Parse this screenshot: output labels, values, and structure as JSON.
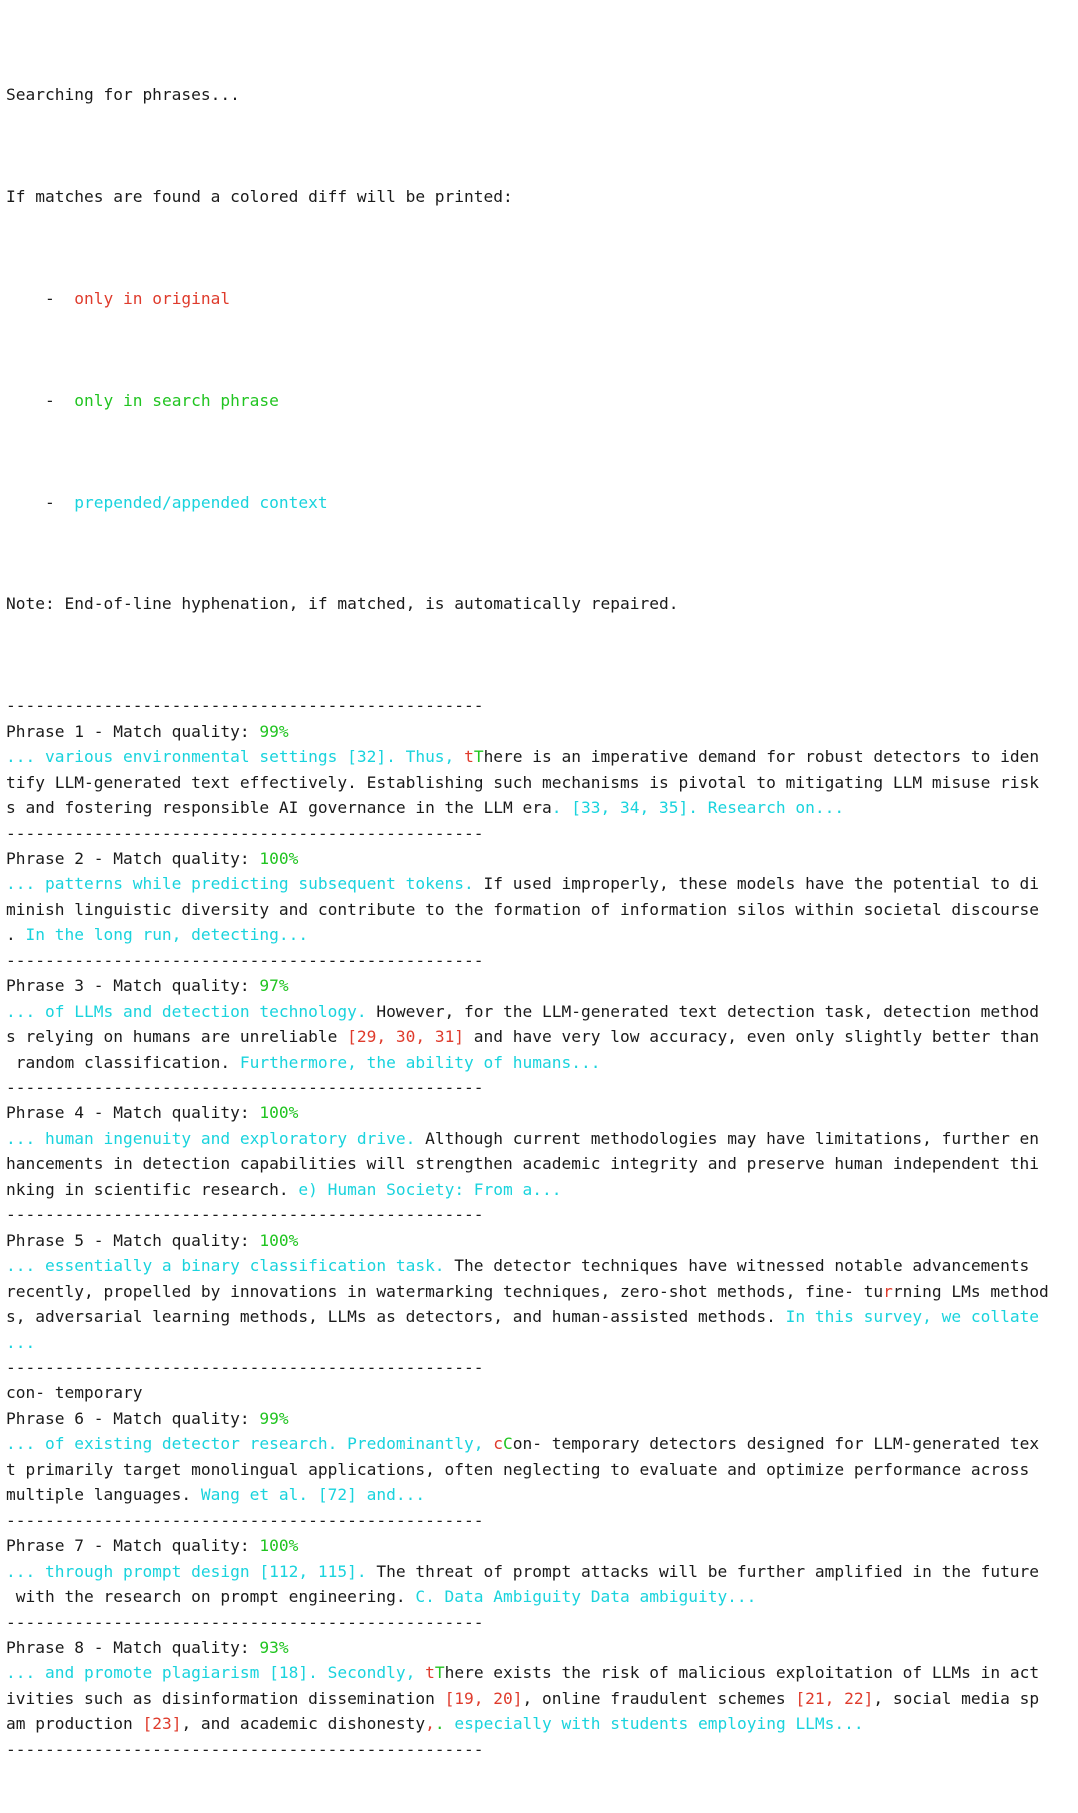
{
  "terminal": {
    "colors": {
      "text": "#1a1a1a",
      "removed": "#df3b2c",
      "added": "#21c421",
      "context": "#19d3dd",
      "background": "#ffffff"
    },
    "rule": "-------------------------------------------------",
    "header": {
      "line1": "Searching for phrases...",
      "line2": "If matches are found a colored diff will be printed:",
      "legend": [
        {
          "bullet": "    -  ",
          "label": "only in original",
          "color": "removed"
        },
        {
          "bullet": "    -  ",
          "label": "only in search phrase",
          "color": "added"
        },
        {
          "bullet": "    -  ",
          "label": "prepended/appended context",
          "color": "context"
        }
      ],
      "note": "Note: End-of-line hyphenation, if matched, is automatically repaired."
    },
    "stray_line": "con- temporary",
    "phrases": [
      {
        "label": "Phrase 1 - Match quality: ",
        "quality": "99%",
        "lines": [
          [
            {
              "t": "... various environmental settings [32]. Thus, ",
              "c": "context"
            },
            {
              "t": "t",
              "c": "removed"
            },
            {
              "t": "T",
              "c": "added"
            },
            {
              "t": "here is an imperative demand for robust detectors to iden",
              "c": "plain"
            }
          ],
          [
            {
              "t": "tify LLM-generated text effectively. Establishing such mechanisms is pivotal to mitigating LLM misuse risk",
              "c": "plain"
            }
          ],
          [
            {
              "t": "s and fostering responsible AI governance in the LLM era",
              "c": "plain"
            },
            {
              "t": ". [33, 34, 35]. Research on...",
              "c": "context"
            }
          ]
        ]
      },
      {
        "label": "Phrase 2 - Match quality: ",
        "quality": "100%",
        "lines": [
          [
            {
              "t": "... patterns while predicting subsequent tokens.",
              "c": "context"
            },
            {
              "t": " If used improperly, these models have the potential to di",
              "c": "plain"
            }
          ],
          [
            {
              "t": "minish linguistic diversity and contribute to the formation of information silos within societal discourse",
              "c": "plain"
            }
          ],
          [
            {
              "t": ".",
              "c": "plain"
            },
            {
              "t": " In the long run, detecting...",
              "c": "context"
            }
          ]
        ]
      },
      {
        "label": "Phrase 3 - Match quality: ",
        "quality": "97%",
        "lines": [
          [
            {
              "t": "... of LLMs and detection technology.",
              "c": "context"
            },
            {
              "t": " However, for the LLM-generated text detection task, detection method",
              "c": "plain"
            }
          ],
          [
            {
              "t": "s relying on humans are unreliable ",
              "c": "plain"
            },
            {
              "t": "[29, 30, 31]",
              "c": "removed"
            },
            {
              "t": " and have very low accuracy, even only slightly better than",
              "c": "plain"
            }
          ],
          [
            {
              "t": " random classification.",
              "c": "plain"
            },
            {
              "t": " Furthermore, the ability of humans...",
              "c": "context"
            }
          ]
        ]
      },
      {
        "label": "Phrase 4 - Match quality: ",
        "quality": "100%",
        "lines": [
          [
            {
              "t": "... human ingenuity and exploratory drive.",
              "c": "context"
            },
            {
              "t": " Although current methodologies may have limitations, further en",
              "c": "plain"
            }
          ],
          [
            {
              "t": "hancements in detection capabilities will strengthen academic integrity and preserve human independent thi",
              "c": "plain"
            }
          ],
          [
            {
              "t": "nking in scientific research.",
              "c": "plain"
            },
            {
              "t": " e) Human Society: From a...",
              "c": "context"
            }
          ]
        ]
      },
      {
        "label": "Phrase 5 - Match quality: ",
        "quality": "100%",
        "lines": [
          [
            {
              "t": "... essentially a binary classification task.",
              "c": "context"
            },
            {
              "t": " The detector techniques have witnessed notable advancements",
              "c": "plain"
            }
          ],
          [
            {
              "t": "recently, propelled by innovations in watermarking techniques, zero-shot methods, fine- tu",
              "c": "plain"
            },
            {
              "t": "r",
              "c": "removed"
            },
            {
              "t": "rning LMs method",
              "c": "plain"
            }
          ],
          [
            {
              "t": "s, adversarial learning methods, LLMs as detectors, and human-assisted methods.",
              "c": "plain"
            },
            {
              "t": " In this survey, we collate",
              "c": "context"
            }
          ],
          [
            {
              "t": "...",
              "c": "context"
            }
          ]
        ]
      },
      {
        "label": "Phrase 6 - Match quality: ",
        "quality": "99%",
        "lines": [
          [
            {
              "t": "... of existing detector research. Predominantly, ",
              "c": "context"
            },
            {
              "t": "c",
              "c": "removed"
            },
            {
              "t": "C",
              "c": "added"
            },
            {
              "t": "on- temporary detectors designed for LLM-generated tex",
              "c": "plain"
            }
          ],
          [
            {
              "t": "t primarily target monolingual applications, often neglecting to evaluate and optimize performance across",
              "c": "plain"
            }
          ],
          [
            {
              "t": "multiple languages.",
              "c": "plain"
            },
            {
              "t": " Wang et al. [72] and...",
              "c": "context"
            }
          ]
        ]
      },
      {
        "label": "Phrase 7 - Match quality: ",
        "quality": "100%",
        "lines": [
          [
            {
              "t": "... through prompt design [112, 115].",
              "c": "context"
            },
            {
              "t": " The threat of prompt attacks will be further amplified in the future",
              "c": "plain"
            }
          ],
          [
            {
              "t": " with the research on prompt engineering.",
              "c": "plain"
            },
            {
              "t": " C. Data Ambiguity Data ambiguity...",
              "c": "context"
            }
          ]
        ]
      },
      {
        "label": "Phrase 8 - Match quality: ",
        "quality": "93%",
        "lines": [
          [
            {
              "t": "... and promote plagiarism [18]. Secondly, ",
              "c": "context"
            },
            {
              "t": "t",
              "c": "removed"
            },
            {
              "t": "T",
              "c": "added"
            },
            {
              "t": "here exists the risk of malicious exploitation of LLMs in act",
              "c": "plain"
            }
          ],
          [
            {
              "t": "ivities such as disinformation dissemination ",
              "c": "plain"
            },
            {
              "t": "[19, 20]",
              "c": "removed"
            },
            {
              "t": ", online fraudulent schemes ",
              "c": "plain"
            },
            {
              "t": "[21, 22]",
              "c": "removed"
            },
            {
              "t": ", social media sp",
              "c": "plain"
            }
          ],
          [
            {
              "t": "am production ",
              "c": "plain"
            },
            {
              "t": "[23]",
              "c": "removed"
            },
            {
              "t": ", and academic dishonesty",
              "c": "plain"
            },
            {
              "t": ",",
              "c": "removed"
            },
            {
              "t": ".",
              "c": "added"
            },
            {
              "t": " especially with students employing LLMs...",
              "c": "context"
            }
          ]
        ]
      }
    ]
  }
}
